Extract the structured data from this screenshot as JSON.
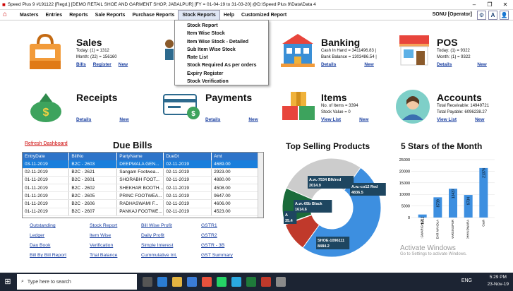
{
  "window": {
    "title": "Speed Plus 9 #191122  [Regd.]  [DEMO RETAIL SHOE AND GARMENT SHOP, JABALPUR] [FY = 01-04-19 to 31-03-20]  @D:\\Speed Plus 9\\Data\\Data 4"
  },
  "menu": {
    "items": [
      "Masters",
      "Entries",
      "Reports",
      "Sale Reports",
      "Purchase Reports",
      "Stock Reports",
      "Help",
      "Customized Report"
    ],
    "user": "SONU [Operator]",
    "font_btn": "A"
  },
  "dropdown": {
    "items": [
      "Stock Report",
      "Item Wise Stock",
      "Item Wise Stock - Detailed",
      "Sub Item Wise Stock",
      "Rate List",
      "Stock Required As per orders",
      "Expiry Register",
      "Stock Verification"
    ]
  },
  "tiles": {
    "sales": {
      "title": "Sales",
      "line1": "Today: (1) = 1312",
      "line2": "Month: (22) = 156160",
      "links": [
        "Bills",
        "Register",
        "New"
      ]
    },
    "banking": {
      "title": "Banking",
      "line1": "Cash In Hand = 3411496.83 |",
      "line2": "Bank Balance = 1303486.54 |",
      "links": [
        "Details",
        "New"
      ]
    },
    "pos": {
      "title": "POS",
      "line1": "Today: (1) = 9322",
      "line2": "Month: (1) = 9322",
      "links": [
        "Details",
        "New"
      ]
    },
    "receipts": {
      "title": "Receipts",
      "links": [
        "Details",
        "New"
      ]
    },
    "payments": {
      "title": "Payments",
      "links": [
        "Details",
        "New"
      ]
    },
    "items": {
      "title": "Items",
      "line1": "No. of Items = 3394",
      "line2": "Stock Value = 0",
      "links": [
        "View List",
        "New"
      ]
    },
    "accounts": {
      "title": "Accounts",
      "line1": "Total Receivable: 14949721",
      "line2": "Total Payable: 6096238.27",
      "links": [
        "View List",
        "New"
      ]
    }
  },
  "due_bills": {
    "refresh": "Refresh Dashboard",
    "title": "Due Bills",
    "columns": [
      "EntryDate",
      "BillNo",
      "PartyName",
      "DueDt",
      "Amt"
    ],
    "rows": [
      [
        "03-11-2019",
        "B2C - 2603",
        "DEEPMALA GEN...",
        "02-11-2019",
        "4689.00"
      ],
      [
        "02-11-2019",
        "B2C - 2621",
        "Sangam Footwea...",
        "02-11-2019",
        "2923.00"
      ],
      [
        "01-11-2019",
        "B2C - 2601",
        "SHORABH FOOT...",
        "02-11-2019",
        "4880.00"
      ],
      [
        "01-11-2019",
        "B2C - 2602",
        "SHEKHAR BOOTH...",
        "02-11-2019",
        "4508.00"
      ],
      [
        "01-11-2019",
        "B2C - 2605",
        "PRINC FOOTWEA...",
        "02-11-2019",
        "9647.00"
      ],
      [
        "01-11-2019",
        "B2C - 2606",
        "RADHASWAMI F...",
        "02-11-2019",
        "4606.00"
      ],
      [
        "01-11-2019",
        "B2C - 2607",
        "PANKAJ FOOTWE...",
        "02-11-2019",
        "4523.00"
      ]
    ]
  },
  "quick_links": [
    "Outstanding",
    "Stock Report",
    "Bill Wise Profit",
    "GSTR1",
    "Ledger",
    "Item Wise",
    "Daily Profit",
    "GSTR2",
    "Day Book",
    "Verification",
    "Simple Interest",
    "GSTR - 3B",
    "Bill By Bill Report",
    "Trial Balance",
    "Cummulative Int.",
    "GST Summary"
  ],
  "top_products": {
    "title": "Top Selling Products"
  },
  "stars": {
    "title": "5 Stars of the Month"
  },
  "chart_data": [
    {
      "type": "pie",
      "title": "Top Selling Products",
      "slices": [
        {
          "label": "SHOE-1096111\n8484.2",
          "value": 8484.2,
          "color": "#3d8fe0"
        },
        {
          "label": "A.w.-05b Black\n1614.6",
          "value": 1614.6,
          "color": "#c0392b"
        },
        {
          "label": "A\n35.4",
          "value": 35.4,
          "color": "#2e4f7a"
        },
        {
          "label": "A.w.-7534 Blk/red\n2014.9",
          "value": 2014.9,
          "color": "#1a6b3a"
        },
        {
          "label": "A.w.-co12 Red\n4836.5",
          "value": 4836.5,
          "color": "#cccccc"
        }
      ]
    },
    {
      "type": "bar",
      "title": "5 Stars of the Month",
      "ylim": [
        0,
        25000
      ],
      "yticks": [
        0,
        5000,
        10000,
        15000,
        20000,
        25000
      ],
      "categories": [
        "AAKASH FOOTWEAR GWARIGHAT",
        "AKASH FOOTWEAR MANDLA",
        "AVTAR BOOTHOUSE NARSINGPUR",
        "BALA JI FOOTWEAR CHHINDWARA",
        "Cash"
      ],
      "values": [
        1312,
        8739,
        12437,
        9734,
        21376
      ],
      "data_labels": [
        "1312",
        "8739",
        "12437",
        "9734",
        "21376"
      ],
      "color": "#3d8fe0"
    }
  ],
  "watermark": {
    "line1": "Activate Windows",
    "line2": "Go to Settings to activate Windows."
  },
  "taskbar": {
    "search": "Type here to search",
    "time": "5:29 PM",
    "date": "23-Nov-19",
    "lang": "ENG"
  }
}
